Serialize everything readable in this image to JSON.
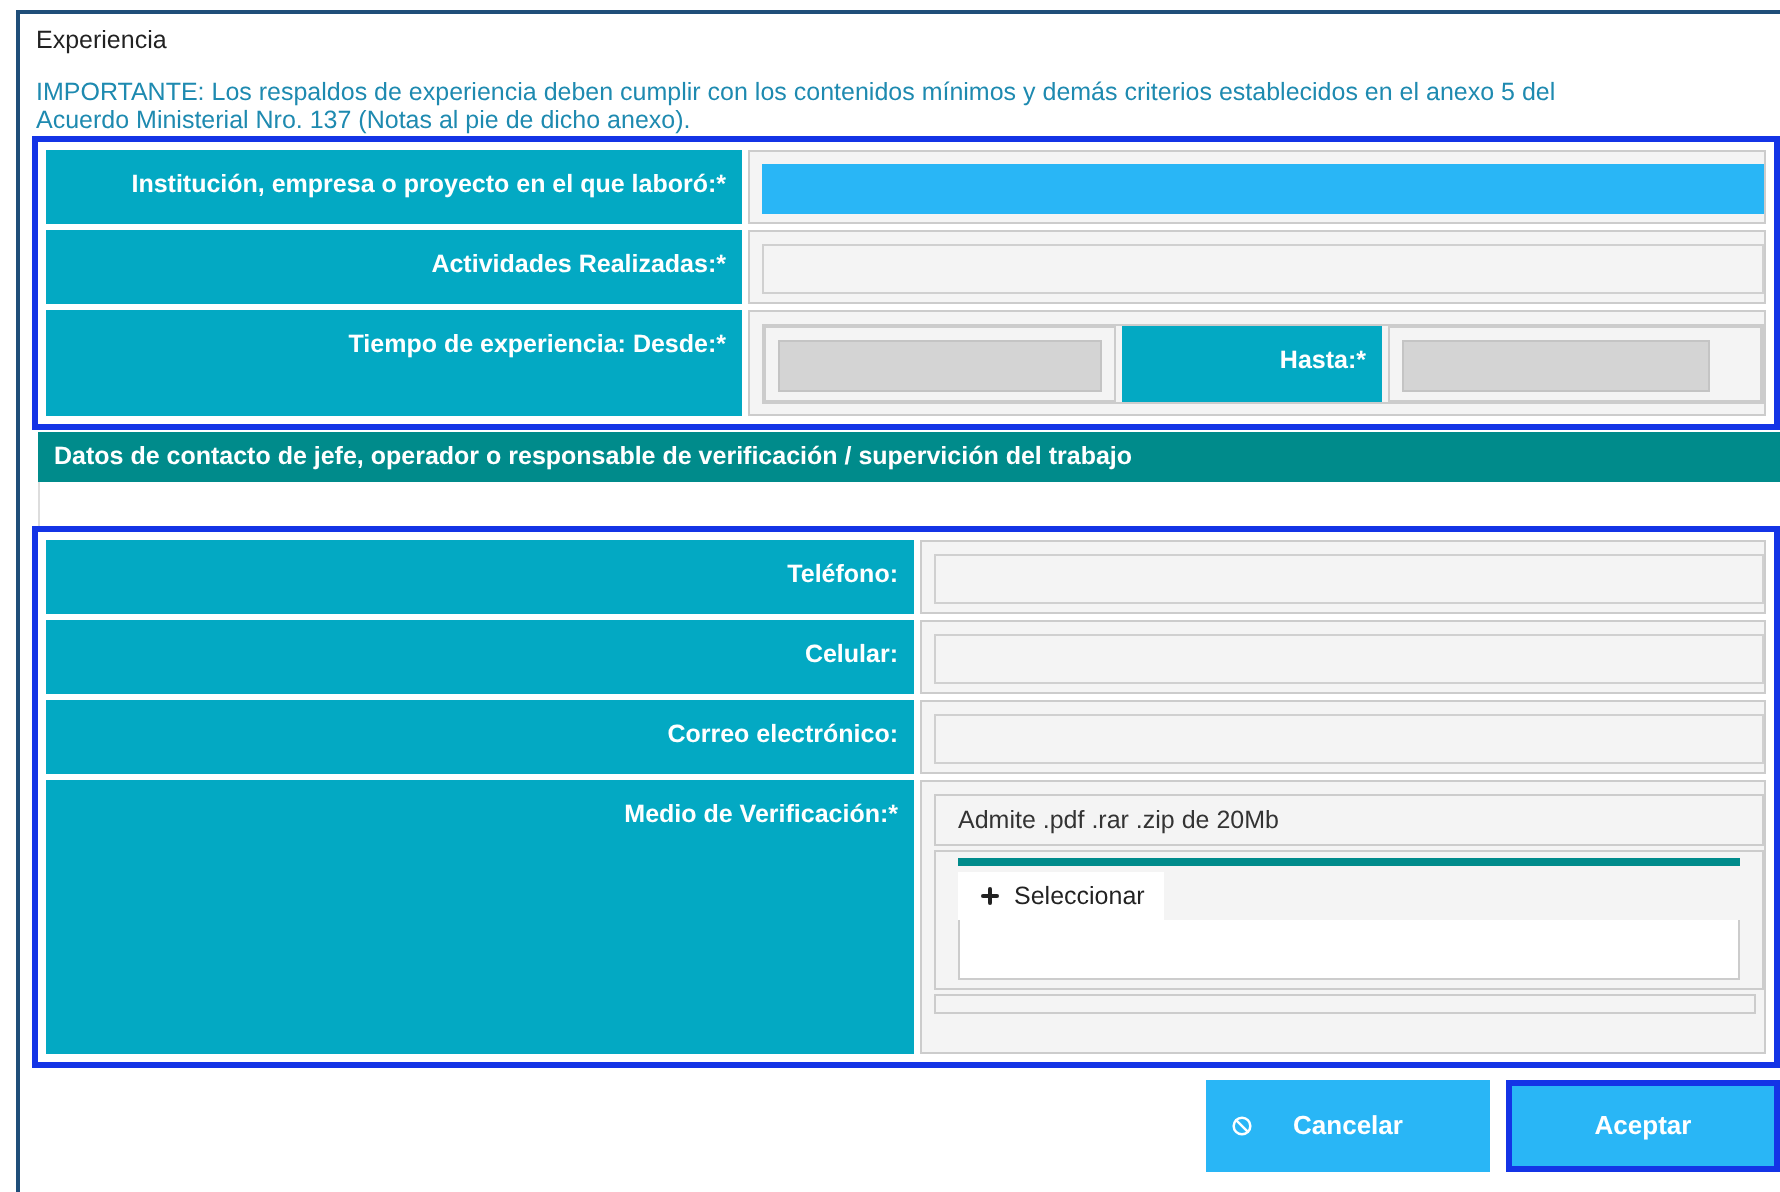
{
  "section_title": "Experiencia",
  "notice": "IMPORTANTE: Los respaldos de experiencia deben cumplir con los contenidos mínimos y demás criterios establecidos en el anexo 5 del Acuerdo Ministerial Nro. 137 (Notas al pie de dicho anexo).",
  "experience_fields": [
    {
      "label": "Institución, empresa o proyecto en el que laboró:*",
      "focused": true
    },
    {
      "label": "Actividades Realizadas:*",
      "focused": false
    }
  ],
  "period": {
    "from_label": "Tiempo de experiencia: Desde:*",
    "to_label": "Hasta:*"
  },
  "contact_header": "Datos de contacto de jefe, operador o responsable de verificación / supervición del trabajo",
  "contact_fields": [
    {
      "label": "Teléfono:"
    },
    {
      "label": "Celular:"
    },
    {
      "label": "Correo electrónico:"
    }
  ],
  "upload": {
    "label": "Medio de Verificación:*",
    "hint": "Admite .pdf .rar .zip de 20Mb",
    "button": "Seleccionar"
  },
  "buttons": [
    {
      "label": "Cancelar",
      "kind": "cancel",
      "focused": false
    },
    {
      "label": "Aceptar",
      "kind": "accept",
      "focused": true
    }
  ]
}
